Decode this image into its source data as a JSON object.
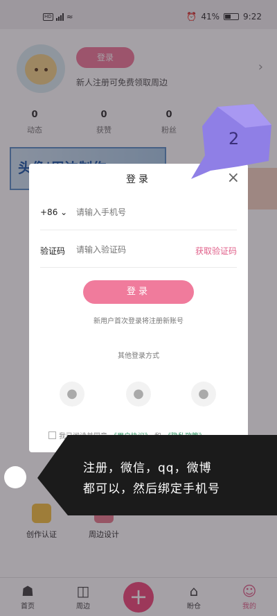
{
  "status_bar": {
    "network": "HD",
    "battery_percent": "41%",
    "time": "9:22"
  },
  "profile": {
    "login_button": "登录",
    "subtitle": "新人注册可免费领取周边",
    "stats": [
      {
        "value": "0",
        "label": "动态"
      },
      {
        "value": "0",
        "label": "获赞"
      },
      {
        "value": "0",
        "label": "粉丝"
      }
    ],
    "banner_text": "头像|周边制作",
    "grid": [
      {
        "label": "创作认证"
      },
      {
        "label": "周边设计"
      }
    ]
  },
  "bottom_nav": {
    "items": [
      {
        "label": "首页"
      },
      {
        "label": "周边"
      },
      {
        "label": "盼仓"
      },
      {
        "label": "我的"
      }
    ],
    "plus": "+"
  },
  "dialog": {
    "title": "登录",
    "close": "×",
    "country_code": "+86",
    "phone_placeholder": "请输入手机号",
    "code_label": "验证码",
    "code_placeholder": "请输入验证码",
    "get_code": "获取验证码",
    "login_button": "登录",
    "new_user_note": "新用户首次登录将注册新账号",
    "other_methods": "其他登录方式",
    "agreement_prefix": "我已阅读并同意",
    "user_agreement": "《用户协议》",
    "agreement_and": "和",
    "privacy_policy": "《隐私政策》"
  },
  "annotation": {
    "step": "2",
    "line1": "注册，微信，qq，微博",
    "line2": "都可以，然后绑定手机号"
  }
}
